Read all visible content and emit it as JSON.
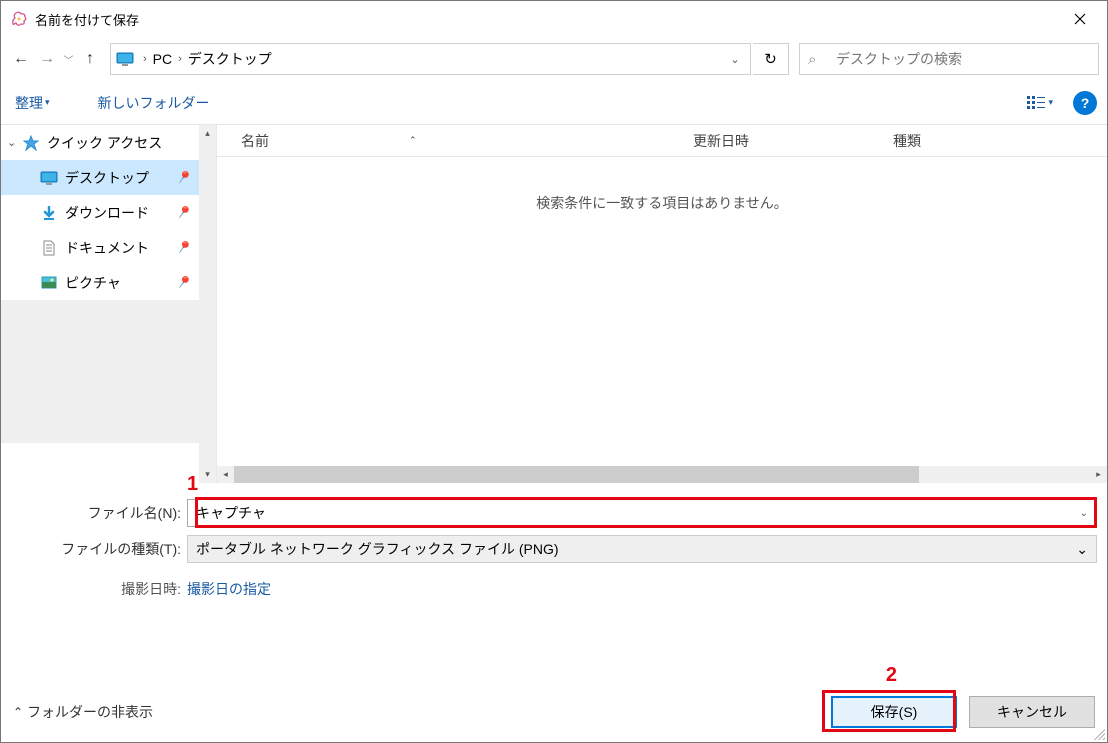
{
  "title": "名前を付けて保存",
  "breadcrumb": {
    "pc": "PC",
    "location": "デスクトップ"
  },
  "search": {
    "placeholder": "デスクトップの検索"
  },
  "toolbar": {
    "organize": "整理",
    "new_folder": "新しいフォルダー"
  },
  "sidebar": {
    "quick_access": "クイック アクセス",
    "items": [
      {
        "label": "デスクトップ"
      },
      {
        "label": "ダウンロード"
      },
      {
        "label": "ドキュメント"
      },
      {
        "label": "ピクチャ"
      }
    ]
  },
  "columns": {
    "name": "名前",
    "date": "更新日時",
    "type": "種類"
  },
  "empty_message": "検索条件に一致する項目はありません。",
  "form": {
    "filename_label": "ファイル名(N):",
    "filename_value": "キャプチャ",
    "filetype_label": "ファイルの種類(T):",
    "filetype_value": "ポータブル ネットワーク グラフィックス ファイル (PNG)",
    "shoot_date_label": "撮影日時:",
    "shoot_date_link": "撮影日の指定"
  },
  "footer": {
    "hide_folders": "フォルダーの非表示",
    "save": "保存(S)",
    "cancel": "キャンセル"
  },
  "annotations": {
    "one": "1",
    "two": "2"
  }
}
